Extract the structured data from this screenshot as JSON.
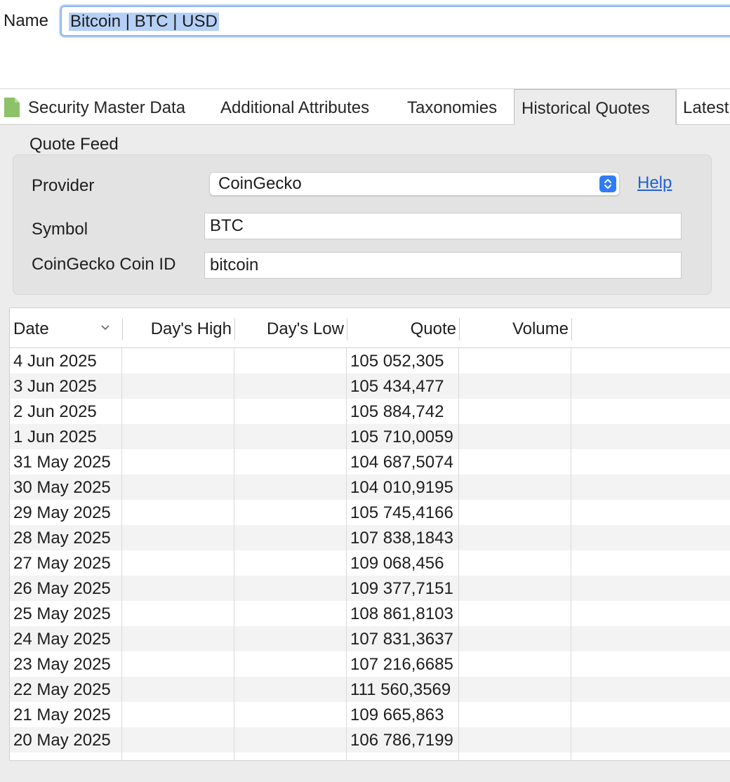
{
  "name_field": {
    "label": "Name",
    "value": "Bitcoin | BTC | USD"
  },
  "tabs": [
    {
      "label": "Security Master Data",
      "active": false
    },
    {
      "label": "Additional Attributes",
      "active": false
    },
    {
      "label": "Taxonomies",
      "active": false
    },
    {
      "label": "Historical Quotes",
      "active": true
    },
    {
      "label": "Latest",
      "active": false
    }
  ],
  "quote_feed": {
    "title": "Quote Feed",
    "provider_label": "Provider",
    "provider_value": "CoinGecko",
    "help_label": "Help",
    "symbol_label": "Symbol",
    "symbol_value": "BTC",
    "coin_id_label": "CoinGecko Coin ID",
    "coin_id_value": "bitcoin"
  },
  "table": {
    "headers": {
      "date": "Date",
      "high": "Day's High",
      "low": "Day's Low",
      "quote": "Quote",
      "volume": "Volume"
    },
    "rows": [
      {
        "date": "4 Jun 2025",
        "high": "",
        "low": "",
        "quote": "105 052,305",
        "volume": ""
      },
      {
        "date": "3 Jun 2025",
        "high": "",
        "low": "",
        "quote": "105 434,477",
        "volume": ""
      },
      {
        "date": "2 Jun 2025",
        "high": "",
        "low": "",
        "quote": "105 884,742",
        "volume": ""
      },
      {
        "date": "1 Jun 2025",
        "high": "",
        "low": "",
        "quote": "105 710,0059",
        "volume": ""
      },
      {
        "date": "31 May 2025",
        "high": "",
        "low": "",
        "quote": "104 687,5074",
        "volume": ""
      },
      {
        "date": "30 May 2025",
        "high": "",
        "low": "",
        "quote": "104 010,9195",
        "volume": ""
      },
      {
        "date": "29 May 2025",
        "high": "",
        "low": "",
        "quote": "105 745,4166",
        "volume": ""
      },
      {
        "date": "28 May 2025",
        "high": "",
        "low": "",
        "quote": "107 838,1843",
        "volume": ""
      },
      {
        "date": "27 May 2025",
        "high": "",
        "low": "",
        "quote": "109 068,456",
        "volume": ""
      },
      {
        "date": "26 May 2025",
        "high": "",
        "low": "",
        "quote": "109 377,7151",
        "volume": ""
      },
      {
        "date": "25 May 2025",
        "high": "",
        "low": "",
        "quote": "108 861,8103",
        "volume": ""
      },
      {
        "date": "24 May 2025",
        "high": "",
        "low": "",
        "quote": "107 831,3637",
        "volume": ""
      },
      {
        "date": "23 May 2025",
        "high": "",
        "low": "",
        "quote": "107 216,6685",
        "volume": ""
      },
      {
        "date": "22 May 2025",
        "high": "",
        "low": "",
        "quote": "111 560,3569",
        "volume": ""
      },
      {
        "date": "21 May 2025",
        "high": "",
        "low": "",
        "quote": "109 665,863",
        "volume": ""
      },
      {
        "date": "20 May 2025",
        "high": "",
        "low": "",
        "quote": "106 786,7199",
        "volume": ""
      }
    ]
  },
  "icons": {
    "tab_icon": "document-icon",
    "combo_icon": "up-down-chevron-icon",
    "sort_icon": "chevron-down-icon"
  },
  "colors": {
    "accent": "#2f7cf6",
    "link": "#1f63d6",
    "selection": "#b4d0f6",
    "focus_ring": "#8fb5ef",
    "doc_icon": "#8dc26a"
  }
}
